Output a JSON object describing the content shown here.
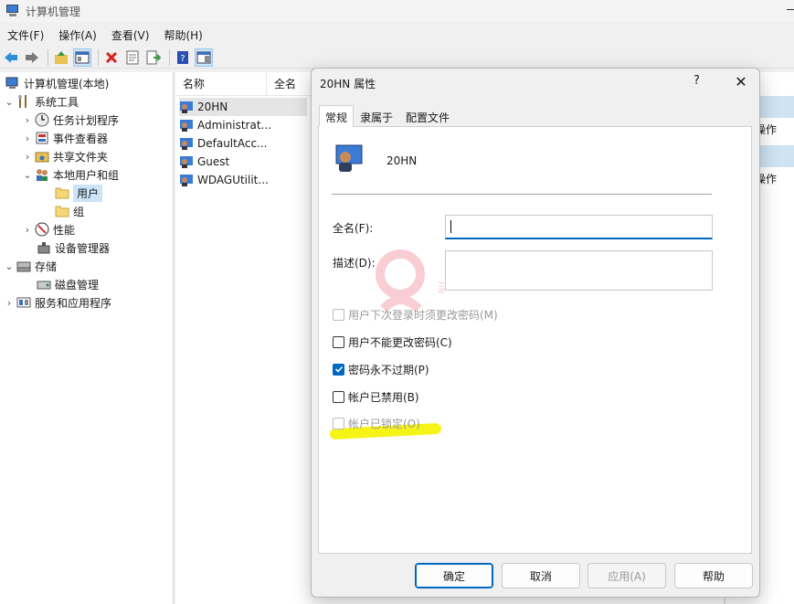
{
  "window": {
    "title": "计算机管理"
  },
  "menu": [
    "文件(F)",
    "操作(A)",
    "查看(V)",
    "帮助(H)"
  ],
  "toolbar": [
    "back-icon",
    "forward-icon",
    "up-folder-icon",
    "show-hide-tree-icon",
    "delete-icon",
    "properties-icon",
    "export-icon",
    "help-icon",
    "view-icon"
  ],
  "tree": {
    "root": "计算机管理(本地)",
    "system_tools": "系统工具",
    "task_scheduler": "任务计划程序",
    "event_viewer": "事件查看器",
    "shared_folders": "共享文件夹",
    "local_users_groups": "本地用户和组",
    "users": "用户",
    "groups": "组",
    "performance": "性能",
    "device_manager": "设备管理器",
    "storage": "存储",
    "disk_management": "磁盘管理",
    "services_apps": "服务和应用程序"
  },
  "list": {
    "columns": [
      "名称",
      "全名"
    ],
    "rows": [
      "20HN",
      "Administrat...",
      "DefaultAcc...",
      "Guest",
      "WDAGUtilit..."
    ]
  },
  "actions": {
    "more1": "更多操作",
    "more2": "更多操作"
  },
  "dialog": {
    "title": "20HN 属性",
    "help": "?",
    "close": "✕",
    "tabs": [
      "常规",
      "隶属于",
      "配置文件"
    ],
    "user_name": "20HN",
    "fullname_label": "全名(F):",
    "fullname_value": "",
    "description_label": "描述(D):",
    "description_value": "",
    "checkboxes": [
      {
        "label": "用户下次登录时须更改密码(M)",
        "checked": false,
        "disabled": true
      },
      {
        "label": "用户不能更改密码(C)",
        "checked": false,
        "disabled": false
      },
      {
        "label": "密码永不过期(P)",
        "checked": true,
        "disabled": false
      },
      {
        "label": "帐户已禁用(B)",
        "checked": false,
        "disabled": false
      },
      {
        "label": "帐户已锁定(O)",
        "checked": false,
        "disabled": true
      }
    ],
    "buttons": {
      "ok": "确定",
      "cancel": "取消",
      "apply": "应用(A)",
      "help": "帮助"
    },
    "highlight_color": "#f5f20a"
  },
  "watermark": {
    "text": "HN"
  },
  "colors": {
    "accent": "#0067c0",
    "selection": "#cce4f7"
  }
}
